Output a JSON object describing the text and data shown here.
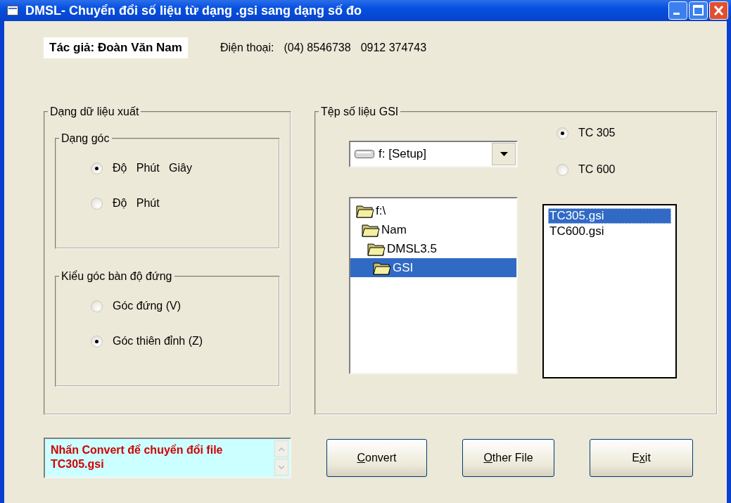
{
  "window": {
    "title": "DMSL- Chuyển đổi số liệu từ dạng .gsi sang dạng số đo"
  },
  "author": "Tác giả: Đoàn Văn Nam",
  "phone_label": "Điện thoại:",
  "phone_numbers": [
    "(04) 8546738",
    "0912 374743"
  ],
  "output_group": {
    "title": "Dạng dữ liệu xuất",
    "groups": [
      {
        "title": "Dạng góc",
        "options": [
          {
            "label": "Độ   Phút   Giây",
            "selected": true
          },
          {
            "label": "Độ   Phút",
            "selected": false
          }
        ]
      },
      {
        "title": "Kiểu góc bàn độ đứng",
        "options": [
          {
            "label": "Góc đứng (V)",
            "selected": false
          },
          {
            "label": "Góc thiên đỉnh (Z)",
            "selected": true
          }
        ]
      }
    ]
  },
  "gsi_group": {
    "title": "Tệp số liệu GSI",
    "drive": "f: [Setup]",
    "instruments": [
      {
        "label": "TC 305",
        "selected": true
      },
      {
        "label": "TC 600",
        "selected": false
      }
    ],
    "folders": [
      {
        "name": "f:\\",
        "selected": false,
        "children": [
          {
            "name": "Nam",
            "selected": false,
            "children": [
              {
                "name": "DMSL3.5",
                "selected": false,
                "children": [
                  {
                    "name": "GSI",
                    "selected": true
                  }
                ]
              }
            ]
          }
        ]
      }
    ],
    "files": [
      {
        "name": "TC305.gsi",
        "selected": true
      },
      {
        "name": "TC600.gsi",
        "selected": false
      }
    ]
  },
  "status": {
    "message": "Nhấn Convert để chuyển đổi file TC305.gsi"
  },
  "buttons": [
    {
      "key": "C",
      "after": "onvert"
    },
    {
      "key": "O",
      "after": "ther File"
    },
    {
      "before": "E",
      "key": "x",
      "after": "it"
    }
  ]
}
